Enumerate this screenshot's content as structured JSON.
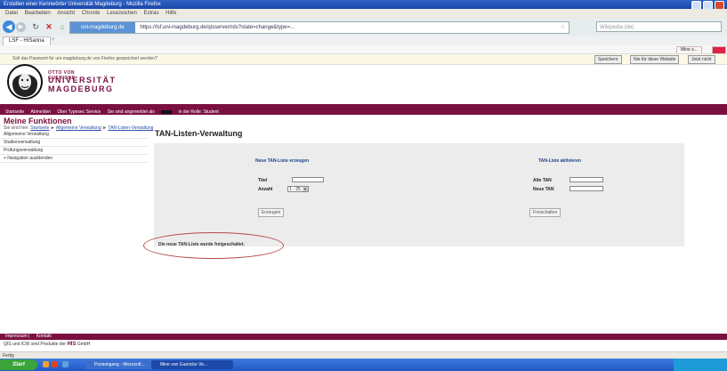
{
  "window": {
    "title": "Erstellen einer Kennwörter Universität Magdeburg - Mozilla Firefox"
  },
  "menu": [
    "Datei",
    "Bearbeiten",
    "Ansicht",
    "Chronik",
    "Lesezeichen",
    "Extras",
    "Hilfe"
  ],
  "browser": {
    "identity": "uni-magdeburg.de",
    "url": "https://lsf.uni-magdeburg.de/qisserver/rds?state=change&type=...",
    "search_placeholder": "Wikipedia (de)",
    "tab_label": "LSF - HISanna",
    "extension_button": "Mine s..."
  },
  "notification": {
    "text": "Soll das Passwort für uni-magdeburg.de von Firefox gespeichert werden?",
    "buttons": [
      "Speichern",
      "Nie für diese Website",
      "Jetzt nicht"
    ]
  },
  "logo": {
    "line1": "OTTO VON GUERICKE",
    "line2": "UNIVERSITÄT",
    "line3": "MAGDEBURG"
  },
  "main_nav": {
    "items": [
      "Startseite",
      "Abmelden",
      "Über Typesec Service",
      "Sie sind angemeldet als",
      "in der Rolle: Student"
    ]
  },
  "sidebar": {
    "heading": "Meine Funktionen",
    "breadcrumb_prefix": "Sie sind hier:",
    "breadcrumb": [
      "Startseite",
      "Allgemeine Verwaltung",
      "TAN-Listen-Verwaltung"
    ],
    "items": [
      "Allgemeine Verwaltung",
      "Studienverwaltung",
      "Prüfungsverwaltung",
      "+ Navigation ausblenden"
    ]
  },
  "content": {
    "title": "TAN-Listen-Verwaltung",
    "create_heading": "Neue TAN-Liste erzeugen",
    "activate_heading": "TAN-Liste aktivieren",
    "fields": {
      "titel_label": "Titel",
      "anzahl_label": "Anzahl",
      "anzahl_value": "1 - 25",
      "alte_tan_label": "Alte TAN",
      "neue_tan_label": "Neue TAN"
    },
    "buttons": {
      "erzeugen": "Erzeugen",
      "freischalten": "Freischalten"
    },
    "message": "Die neue TAN-Liste wurde freigeschaltet."
  },
  "footer": {
    "links": [
      "Impressum",
      "Kontakt"
    ],
    "copyright_prefix": "QIS und ICW sind Produkte der",
    "his": "HIS",
    "copyright_suffix": "GmbH"
  },
  "status": "Fertig",
  "taskbar": {
    "start": "Start",
    "items": [
      "Posteingang - Microsoft...",
      "Mine von Guericke Ve..."
    ]
  }
}
